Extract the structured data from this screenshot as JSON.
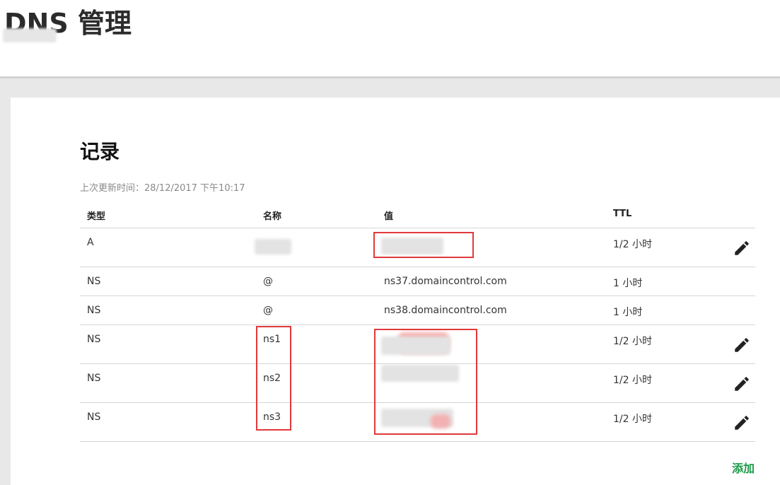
{
  "header": {
    "title": "DNS 管理"
  },
  "records": {
    "title": "记录",
    "last_updated": "上次更新时间：28/12/2017 下午10:17",
    "columns": {
      "type": "类型",
      "name": "名称",
      "value": "值",
      "ttl": "TTL"
    },
    "rows": [
      {
        "type": "A",
        "name": "",
        "value": "",
        "ttl": "1/2 小时",
        "editable": true
      },
      {
        "type": "NS",
        "name": "@",
        "value": "ns37.domaincontrol.com",
        "ttl": "1 小时",
        "editable": false
      },
      {
        "type": "NS",
        "name": "@",
        "value": "ns38.domaincontrol.com",
        "ttl": "1 小时",
        "editable": false
      },
      {
        "type": "NS",
        "name": "ns1",
        "value": "",
        "ttl": "1/2 小时",
        "editable": true
      },
      {
        "type": "NS",
        "name": "ns2",
        "value": "",
        "ttl": "1/2 小时",
        "editable": true
      },
      {
        "type": "NS",
        "name": "ns3",
        "value": "",
        "ttl": "1/2 小时",
        "editable": true
      }
    ],
    "add_label": "添加"
  },
  "icons": {
    "edit": "pencil-icon"
  },
  "colors": {
    "accent_green": "#1a9a48",
    "highlight_red": "#e0393b"
  }
}
